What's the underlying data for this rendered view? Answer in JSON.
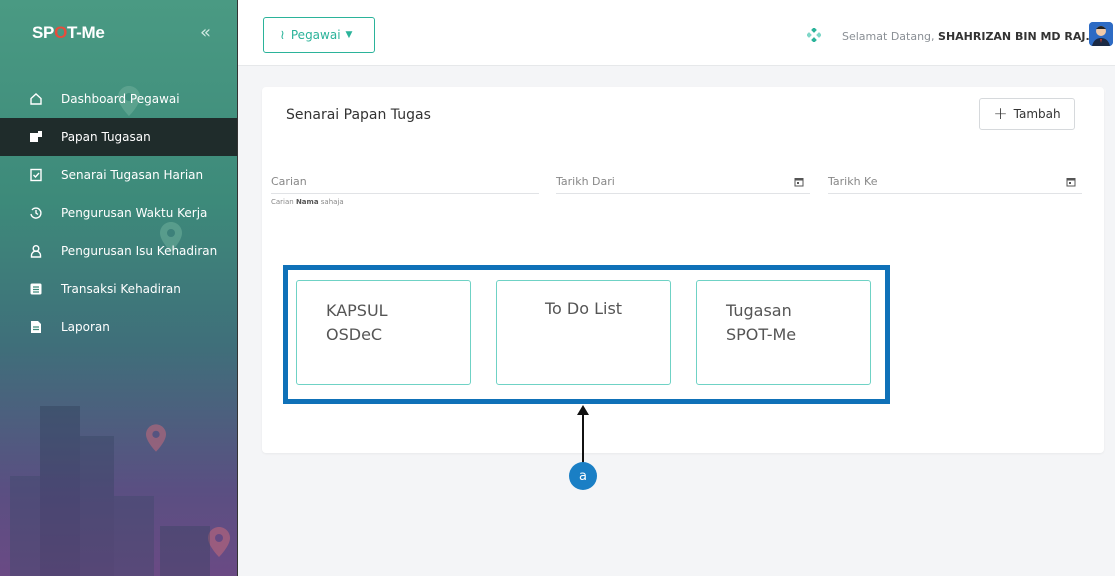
{
  "app": {
    "logo_text_pre": "SP",
    "logo_text_o": "O",
    "logo_text_post": "T-Me",
    "collapse_glyph": "«"
  },
  "sidebar": {
    "items": [
      {
        "label": "Dashboard Pegawai",
        "icon": "home-icon",
        "active": false
      },
      {
        "label": "Papan Tugasan",
        "icon": "board-icon",
        "active": true
      },
      {
        "label": "Senarai Tugasan Harian",
        "icon": "checklist-icon",
        "active": false
      },
      {
        "label": "Pengurusan Waktu Kerja",
        "icon": "clock-history-icon",
        "active": false
      },
      {
        "label": "Pengurusan Isu Kehadiran",
        "icon": "user-icon",
        "active": false
      },
      {
        "label": "Transaksi Kehadiran",
        "icon": "list-icon",
        "active": false
      },
      {
        "label": "Laporan",
        "icon": "report-icon",
        "active": false
      }
    ]
  },
  "topbar": {
    "role_label": "Pegawai",
    "welcome_prefix": "Selamat Datang,",
    "user_name": "SHAHRIZAN BIN MD RAJ..."
  },
  "main": {
    "title": "Senarai Papan Tugas",
    "add_button_label": "Tambah",
    "search": {
      "placeholder": "Carian",
      "hint_prefix": "Carian ",
      "hint_bold": "Nama",
      "hint_suffix": " sahaja"
    },
    "date_from": {
      "placeholder": "Tarikh Dari"
    },
    "date_to": {
      "placeholder": "Tarikh Ke"
    },
    "boards": [
      {
        "line1": "KAPSUL",
        "line2": "OSDeC"
      },
      {
        "line1": "To Do List",
        "line2": ""
      },
      {
        "line1": "Tugasan",
        "line2": "SPOT-Me"
      }
    ]
  },
  "annotation": {
    "badge_label": "a"
  },
  "colors": {
    "accent": "#2bb39a",
    "highlight": "#0f71b8",
    "badge": "#1a7fc5",
    "active_nav": "#1f2c2b"
  }
}
